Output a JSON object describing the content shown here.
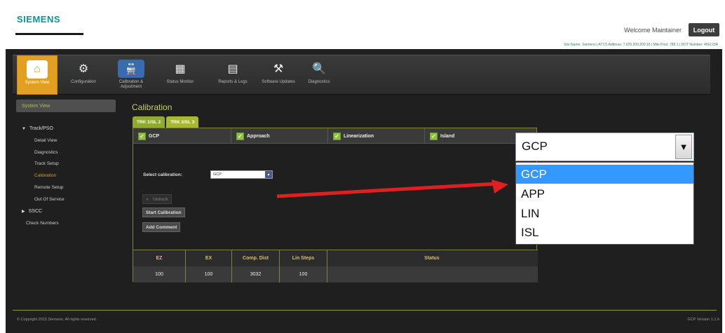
{
  "header": {
    "logo": "SIEMENS",
    "welcome": "Welcome Maintainer",
    "logout_label": "Logout",
    "site_info": "Site Name: Siemens | ATCS Address: 7.620.200.200.16 | Mile Post: 789.1 | DOT Number: 456123A"
  },
  "toolbar": {
    "items": [
      {
        "label": "System View",
        "icon": "house-icon"
      },
      {
        "label": "Configuration",
        "icon": "gears-icon"
      },
      {
        "label": "Calibration & Adjustment",
        "icon": "train-wrench-icon"
      },
      {
        "label": "Status Monitor",
        "icon": "monitor-icon"
      },
      {
        "label": "Reports & Logs",
        "icon": "document-icon"
      },
      {
        "label": "Software Updates",
        "icon": "software-icon"
      },
      {
        "label": "Diagnostics",
        "icon": "magnifier-icon"
      }
    ]
  },
  "sidebar": {
    "header": "System View",
    "tree": [
      {
        "label": "Track/PSO",
        "children": [
          "Detail View",
          "Diagnostics",
          "Track Setup",
          "Calibration",
          "Remote Setup",
          "Out Of Service"
        ]
      },
      {
        "label": "SSCC",
        "children": []
      }
    ],
    "check_numbers": "Check Numbers"
  },
  "content": {
    "title": "Calibration",
    "tabs": [
      "TRK 1/SL 2",
      "TRK 2/SL 3"
    ],
    "cal_types": [
      "GCP",
      "Approach",
      "Linearization",
      "Island"
    ],
    "select_label": "Select calibration:",
    "select_value": "GCP",
    "unlock_label": "Unlock",
    "start_label": "Start Calibration",
    "comment_label": "Add Comment",
    "table": {
      "headers": [
        "EZ",
        "EX",
        "Comp. Dist",
        "Lin Steps",
        "Status"
      ],
      "row": [
        "100",
        "100",
        "3032",
        "100",
        ""
      ]
    }
  },
  "dropdown": {
    "value": "GCP",
    "options": [
      "GCP",
      "APP",
      "LIN",
      "ISL"
    ],
    "selected_index": 0
  },
  "footer": {
    "copyright": "© Copyright 2015 Siemens. All rights reserved.",
    "version": "GCP Version 1.1.6"
  },
  "colors": {
    "accent_orange": "#e3a020",
    "tab_green": "#8faa2c",
    "title_yellow": "#c8d060",
    "highlight_blue": "#3399ff",
    "arrow_red": "#e02020"
  }
}
